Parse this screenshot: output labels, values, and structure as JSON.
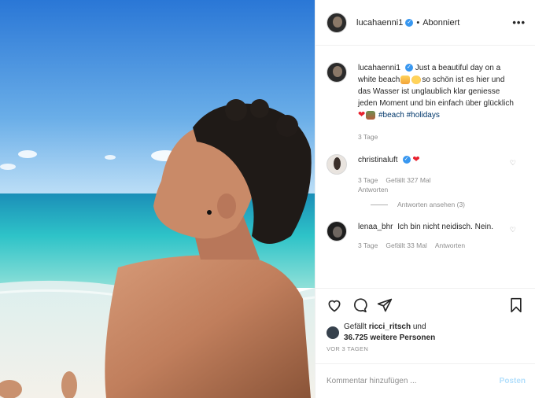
{
  "header": {
    "username": "lucahaenni1",
    "separator": "•",
    "follow_state": "Abonniert",
    "more_icon": "•••"
  },
  "caption": {
    "username": "lucahaenni1",
    "text_part1": "Just a beautiful day on a white beach",
    "text_part2": "so schön ist es hier und das Wasser ist unglaublich klar geniesse jeden Moment und bin einfach über glücklich",
    "hashtag1": "#beach",
    "hashtag2": "#holidays",
    "time": "3 Tage"
  },
  "comments": [
    {
      "username": "christinaluft",
      "time": "3 Tage",
      "likes": "Gefällt 327 Mal",
      "reply": "Antworten",
      "view_replies": "Antworten ansehen (3)"
    },
    {
      "username": "lenaa_bhr",
      "text": "Ich bin nicht neidisch. Nein.",
      "time": "3 Tage",
      "likes": "Gefällt 33 Mal",
      "reply": "Antworten"
    }
  ],
  "likes": {
    "prefix": "Gefällt",
    "user": "ricci_ritsch",
    "connector": "und",
    "count": "36.725 weitere Personen"
  },
  "date": "VOR 3 TAGEN",
  "add_comment": {
    "placeholder": "Kommentar hinzufügen ...",
    "post_label": "Posten"
  },
  "colors": {
    "verified": "#3897f0",
    "hashtag": "#00376b",
    "post_disabled": "#b2dffc",
    "heart": "#e8212e"
  }
}
